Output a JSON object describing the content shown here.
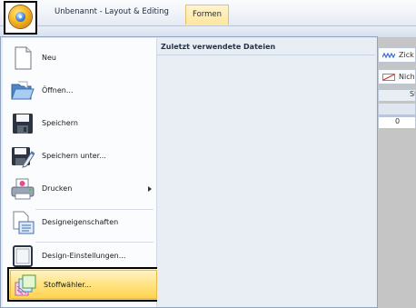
{
  "titlebar": {
    "document_title": "Unbenannt - Layout & Editing",
    "context_tab": "Formen",
    "app_button_icon": "app-orb-icon"
  },
  "menu": {
    "items": [
      {
        "label": "Neu",
        "icon": "new-document-icon"
      },
      {
        "label": "Öffnen...",
        "icon": "open-folder-icon"
      },
      {
        "label": "Speichern",
        "icon": "save-icon"
      },
      {
        "label": "Speichern unter...",
        "icon": "save-as-icon"
      },
      {
        "label": "Drucken",
        "icon": "print-icon",
        "has_submenu": true
      },
      {
        "label": "Designeigenschaften",
        "icon": "design-properties-icon"
      },
      {
        "label": "Design-Einstellungen...",
        "icon": "design-settings-icon"
      },
      {
        "label": "Stoffwähler...",
        "icon": "fabric-selector-icon",
        "highlighted": true
      }
    ],
    "recent_files_header": "Zuletzt verwendete Dateien"
  },
  "background": {
    "row1": "Zick",
    "row2": "Nich",
    "row3": "St",
    "row5": "0"
  },
  "colors": {
    "highlight": "#ffd249",
    "menu_bg": "#e7ecf3",
    "context_tab": "#fde6a0"
  }
}
